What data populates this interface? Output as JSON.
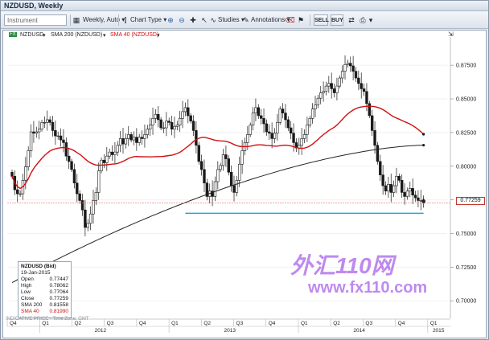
{
  "window": {
    "title": "NZDUSD, Weekly"
  },
  "toolbar": {
    "instrument_placeholder": "Instrument",
    "timeframe": "Weekly, Auto",
    "chart_type": "Chart Type",
    "studies": "Studies",
    "annotations": "Annotations",
    "sell": "SELL",
    "buy": "BUY"
  },
  "legend": {
    "symbol": "NZDUSD",
    "sma200": "SMA 200 (NZDUSD)",
    "sma40": "SMA 40 (NZDUSD)"
  },
  "data_window": {
    "title": "NZDUSD (Bid)",
    "date": "19-Jan-2015",
    "rows": [
      {
        "label": "Open",
        "value": "0.77447"
      },
      {
        "label": "High",
        "value": "0.78062"
      },
      {
        "label": "Low",
        "value": "0.77064"
      },
      {
        "label": "Close",
        "value": "0.77259"
      },
      {
        "label": "SMA 200",
        "value": "0.81558"
      },
      {
        "label": "SMA 40",
        "value": "0.81990"
      }
    ]
  },
  "footer": {
    "note": "INDICATIVE PRICE · Time Zone: GMT"
  },
  "price_tag": "0.77259",
  "watermark": {
    "cn": "外汇110网",
    "url": "www.fx110.com"
  },
  "colors": {
    "sma40": "#d01010",
    "sma200": "#222222",
    "support": "#2aa0d6",
    "candle": "#1a1a1a",
    "price_line": "#e07070"
  },
  "chart_data": {
    "type": "candlestick",
    "symbol": "NZDUSD",
    "timeframe": "Weekly",
    "y_ticks": [
      "0.87500",
      "0.85000",
      "0.82500",
      "0.80000",
      "0.77500",
      "0.75000",
      "0.72500",
      "0.70000"
    ],
    "y_tick_values": [
      0.875,
      0.85,
      0.825,
      0.8,
      0.775,
      0.75,
      0.725,
      0.7
    ],
    "ylim": [
      0.687,
      0.893
    ],
    "x_quarters": [
      "Q4",
      "Q1",
      "Q2",
      "Q3",
      "Q4",
      "Q1",
      "Q2",
      "Q3",
      "Q4",
      "Q1",
      "Q2",
      "Q3",
      "Q4",
      "Q1"
    ],
    "x_years": [
      "2012",
      "2013",
      "2014",
      "2015"
    ],
    "support_level": 0.765,
    "last_close": 0.77259,
    "sma40_last": 0.8199,
    "sma200_last": 0.81558,
    "closes": [
      0.7925,
      0.7825,
      0.7795,
      0.7795,
      0.7895,
      0.7995,
      0.8115,
      0.8255,
      0.8245,
      0.8255,
      0.8275,
      0.8325,
      0.8325,
      0.8345,
      0.8325,
      0.8265,
      0.8225,
      0.8225,
      0.8195,
      0.8175,
      0.8075,
      0.8035,
      0.7975,
      0.7875,
      0.7795,
      0.7745,
      0.7675,
      0.7545,
      0.7575,
      0.7645,
      0.7745,
      0.7805,
      0.7965,
      0.8045,
      0.8025,
      0.8075,
      0.8105,
      0.8085,
      0.8105,
      0.8155,
      0.8205,
      0.8165,
      0.8205,
      0.8235,
      0.8195,
      0.8215,
      0.8175,
      0.8215,
      0.8205,
      0.8235,
      0.8275,
      0.8305,
      0.8355,
      0.8385,
      0.8345,
      0.8285,
      0.8285,
      0.8335,
      0.8325,
      0.8275,
      0.8295,
      0.8305,
      0.8355,
      0.8405,
      0.8435,
      0.8375,
      0.8335,
      0.8265,
      0.8155,
      0.8035,
      0.7975,
      0.7875,
      0.7775,
      0.7815,
      0.7775,
      0.7885,
      0.7975,
      0.8005,
      0.8085,
      0.8055,
      0.7955,
      0.7855,
      0.7805,
      0.7895,
      0.8015,
      0.8115,
      0.8175,
      0.8235,
      0.8305,
      0.8395,
      0.8435,
      0.8375,
      0.8355,
      0.8315,
      0.8255,
      0.8245,
      0.8205,
      0.8245,
      0.8325,
      0.8425,
      0.8395,
      0.8345,
      0.8285,
      0.8245,
      0.8175,
      0.8135,
      0.8155,
      0.8205,
      0.8235,
      0.8305,
      0.8355,
      0.8425,
      0.8455,
      0.8505,
      0.8545,
      0.8555,
      0.8595,
      0.8615,
      0.8575,
      0.8545,
      0.8595,
      0.8655,
      0.8705,
      0.8755,
      0.8765,
      0.8745,
      0.8705,
      0.8655,
      0.8615,
      0.8575,
      0.8555,
      0.8465,
      0.8375,
      0.8265,
      0.8155,
      0.8035,
      0.7935,
      0.7855,
      0.7815,
      0.7865,
      0.7805,
      0.7855,
      0.7925,
      0.7895,
      0.7805,
      0.7775,
      0.7815,
      0.7835,
      0.7785,
      0.7765,
      0.7745,
      0.7745,
      0.7726
    ]
  }
}
